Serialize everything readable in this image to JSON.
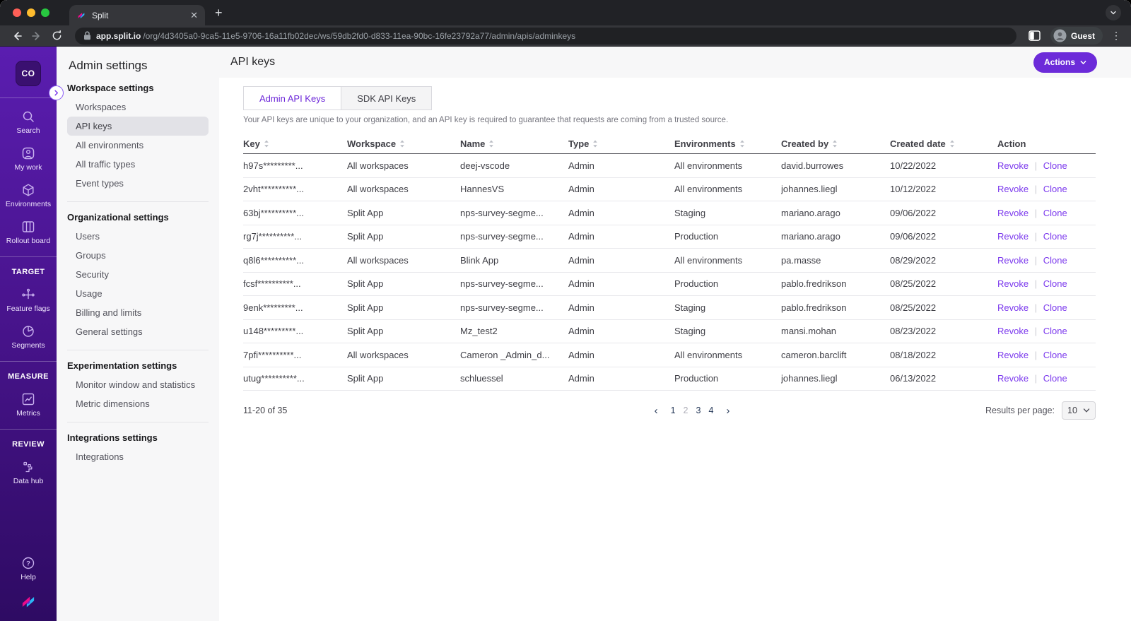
{
  "browser": {
    "tab_title": "Split",
    "url_host": "app.split.io",
    "url_path": "/org/4d3405a0-9ca5-11e5-9706-16a11fb02dec/ws/59db2fd0-d833-11ea-90bc-16fe23792a77/admin/apis/adminkeys",
    "profile_label": "Guest"
  },
  "rail": {
    "logo_text": "CO",
    "primary": [
      {
        "label": "Search",
        "icon": "search-icon"
      },
      {
        "label": "My work",
        "icon": "user-icon"
      },
      {
        "label": "Environments",
        "icon": "cube-icon"
      },
      {
        "label": "Rollout board",
        "icon": "board-icon"
      }
    ],
    "groups": [
      {
        "header": "TARGET",
        "items": [
          {
            "label": "Feature flags",
            "icon": "feature-flags-icon"
          },
          {
            "label": "Segments",
            "icon": "segments-icon"
          }
        ]
      },
      {
        "header": "MEASURE",
        "items": [
          {
            "label": "Metrics",
            "icon": "metrics-icon"
          }
        ]
      },
      {
        "header": "REVIEW",
        "items": [
          {
            "label": "Data hub",
            "icon": "data-hub-icon"
          }
        ]
      }
    ],
    "help_label": "Help"
  },
  "nav": {
    "title": "Admin settings",
    "sections": [
      {
        "header": "Workspace settings",
        "items": [
          "Workspaces",
          "API keys",
          "All environments",
          "All traffic types",
          "Event types"
        ],
        "active_item": "API keys"
      },
      {
        "header": "Organizational settings",
        "items": [
          "Users",
          "Groups",
          "Security",
          "Usage",
          "Billing and limits",
          "General settings"
        ]
      },
      {
        "header": "Experimentation settings",
        "items": [
          "Monitor window and statistics",
          "Metric dimensions"
        ]
      },
      {
        "header": "Integrations settings",
        "items": [
          "Integrations"
        ]
      }
    ]
  },
  "main": {
    "title": "API keys",
    "actions_label": "Actions",
    "tabs": [
      {
        "label": "Admin API Keys",
        "active": true
      },
      {
        "label": "SDK API Keys",
        "active": false
      }
    ],
    "description": "Your API keys are unique to your organization, and an API key is required to guarantee that requests are coming from a trusted source.",
    "table": {
      "columns": [
        {
          "label": "Key",
          "sortable": true
        },
        {
          "label": "Workspace",
          "sortable": true
        },
        {
          "label": "Name",
          "sortable": true
        },
        {
          "label": "Type",
          "sortable": true
        },
        {
          "label": "Environments",
          "sortable": true
        },
        {
          "label": "Created by",
          "sortable": true
        },
        {
          "label": "Created date",
          "sortable": true
        },
        {
          "label": "Action",
          "sortable": false
        }
      ],
      "action_labels": {
        "revoke": "Revoke",
        "clone": "Clone"
      },
      "rows": [
        {
          "key": "h97s*********...",
          "workspace": "All workspaces",
          "name": "deej-vscode",
          "type": "Admin",
          "environments": "All environments",
          "created_by": "david.burrowes",
          "created_date": "10/22/2022"
        },
        {
          "key": "2vht**********...",
          "workspace": "All workspaces",
          "name": "HannesVS",
          "type": "Admin",
          "environments": "All environments",
          "created_by": "johannes.liegl",
          "created_date": "10/12/2022"
        },
        {
          "key": "63bj**********...",
          "workspace": "Split App",
          "name": "nps-survey-segme...",
          "type": "Admin",
          "environments": "Staging",
          "created_by": "mariano.arago",
          "created_date": "09/06/2022"
        },
        {
          "key": "rg7j**********...",
          "workspace": "Split App",
          "name": "nps-survey-segme...",
          "type": "Admin",
          "environments": "Production",
          "created_by": "mariano.arago",
          "created_date": "09/06/2022"
        },
        {
          "key": "q8l6**********...",
          "workspace": "All workspaces",
          "name": "Blink App",
          "type": "Admin",
          "environments": "All environments",
          "created_by": "pa.masse",
          "created_date": "08/29/2022"
        },
        {
          "key": "fcsf**********...",
          "workspace": "Split App",
          "name": "nps-survey-segme...",
          "type": "Admin",
          "environments": "Production",
          "created_by": "pablo.fredrikson",
          "created_date": "08/25/2022"
        },
        {
          "key": "9enk*********...",
          "workspace": "Split App",
          "name": "nps-survey-segme...",
          "type": "Admin",
          "environments": "Staging",
          "created_by": "pablo.fredrikson",
          "created_date": "08/25/2022"
        },
        {
          "key": "u148*********...",
          "workspace": "Split App",
          "name": "Mz_test2",
          "type": "Admin",
          "environments": "Staging",
          "created_by": "mansi.mohan",
          "created_date": "08/23/2022"
        },
        {
          "key": "7pfi**********...",
          "workspace": "All workspaces",
          "name": "Cameron _Admin_d...",
          "type": "Admin",
          "environments": "All environments",
          "created_by": "cameron.barclift",
          "created_date": "08/18/2022"
        },
        {
          "key": "utug**********...",
          "workspace": "Split App",
          "name": "schluessel",
          "type": "Admin",
          "environments": "Production",
          "created_by": "johannes.liegl",
          "created_date": "06/13/2022"
        }
      ]
    },
    "pagination": {
      "range_label": "11-20 of 35",
      "pages": [
        "1",
        "2",
        "3",
        "4"
      ],
      "current_page": "2",
      "results_per_page_label": "Results per page:",
      "results_per_page_value": "10"
    }
  }
}
